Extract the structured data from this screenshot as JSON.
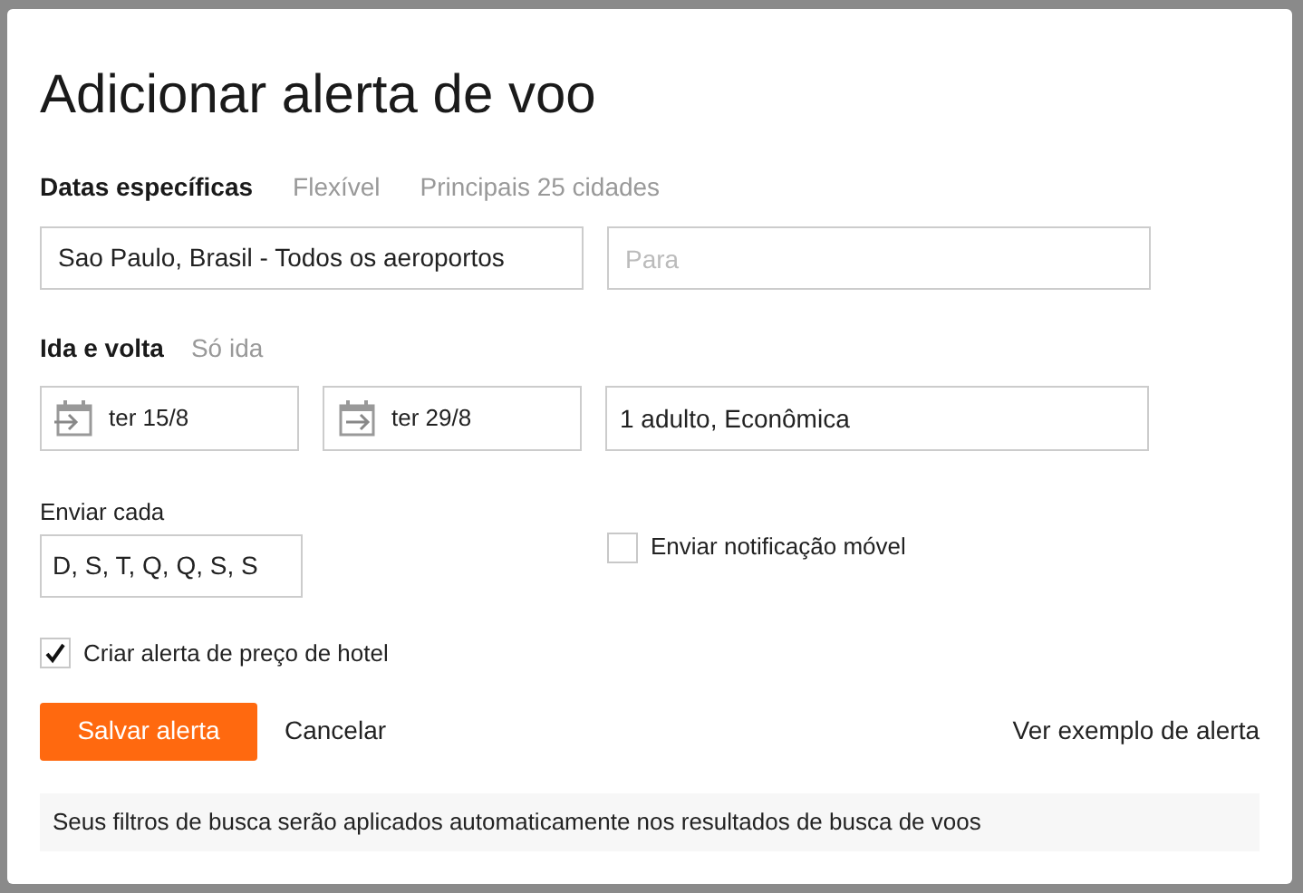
{
  "dialog": {
    "title": "Adicionar alerta de voo"
  },
  "search_tabs": [
    {
      "label": "Datas específicas",
      "selected": true
    },
    {
      "label": "Flexível",
      "selected": false
    },
    {
      "label": "Principais 25 cidades",
      "selected": false
    }
  ],
  "from": {
    "value": "Sao Paulo, Brasil - Todos os aeroportos"
  },
  "to": {
    "placeholder": "Para"
  },
  "trip_tabs": [
    {
      "label": "Ida e volta",
      "selected": true
    },
    {
      "label": "Só ida",
      "selected": false
    }
  ],
  "dates": [
    {
      "value": "ter 15/8",
      "kind": "depart"
    },
    {
      "value": "ter 29/8",
      "kind": "return"
    }
  ],
  "travelers": {
    "value": "1 adulto, Econômica"
  },
  "frequency": {
    "label": "Enviar cada",
    "value": "D, S, T, Q, Q, S, S"
  },
  "mobile_notification": {
    "label": "Enviar notificação móvel",
    "checked": false
  },
  "hotel_alert": {
    "label": "Criar alerta de preço de hotel",
    "checked": true
  },
  "buttons": {
    "save": "Salvar alerta",
    "cancel": "Cancelar",
    "example": "Ver exemplo de alerta"
  },
  "info": "Seus filtros de busca serão aplicados automaticamente nos resultados de busca de voos"
}
